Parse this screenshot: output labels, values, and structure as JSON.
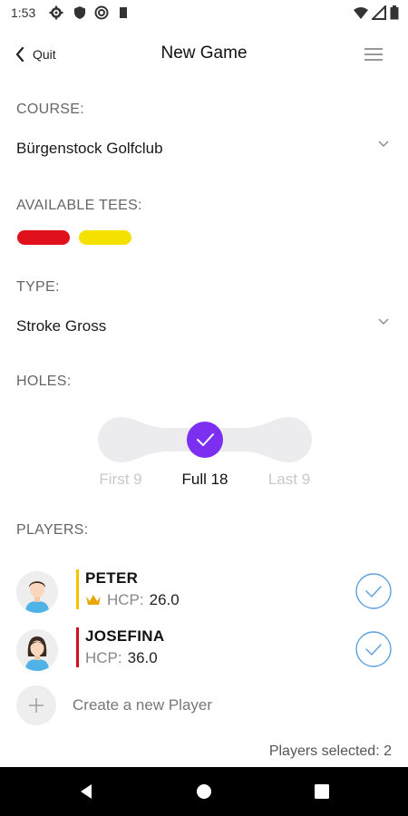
{
  "status_bar": {
    "time": "1:53",
    "left_icons": [
      "gear-icon",
      "shield-icon",
      "sync-circle-icon",
      "sd-card-icon"
    ],
    "right_icons": [
      "wifi-icon",
      "signal-icon",
      "battery-icon"
    ]
  },
  "header": {
    "back_label": "Quit",
    "title": "New Game",
    "menu_icon": "hamburger-menu-icon"
  },
  "course": {
    "label": "COURSE:",
    "value": "Bürgenstock Golfclub"
  },
  "tees": {
    "label": "AVAILABLE TEES:",
    "items": [
      {
        "color": "#e0101d"
      },
      {
        "color": "#f5e100"
      }
    ]
  },
  "type": {
    "label": "TYPE:",
    "value": "Stroke Gross"
  },
  "holes": {
    "label": "HOLES:",
    "options": [
      "First 9",
      "Full 18",
      "Last 9"
    ],
    "selected_index": 1
  },
  "players": {
    "label": "PLAYERS:",
    "items": [
      {
        "name": "PETER",
        "hcp_label": "HCP:",
        "hcp_value": "26.0",
        "tee_color": "#f5c400",
        "crown": true,
        "selected": true
      },
      {
        "name": "JOSEFINA",
        "hcp_label": "HCP:",
        "hcp_value": "36.0",
        "tee_color": "#d0101d",
        "crown": false,
        "selected": true
      }
    ],
    "create_label": "Create a new Player",
    "selected_text": "Players selected: 2"
  },
  "colors": {
    "accent": "#7c2ff0",
    "check_ring": "#5aa0e0",
    "crown": "#e6a800"
  }
}
